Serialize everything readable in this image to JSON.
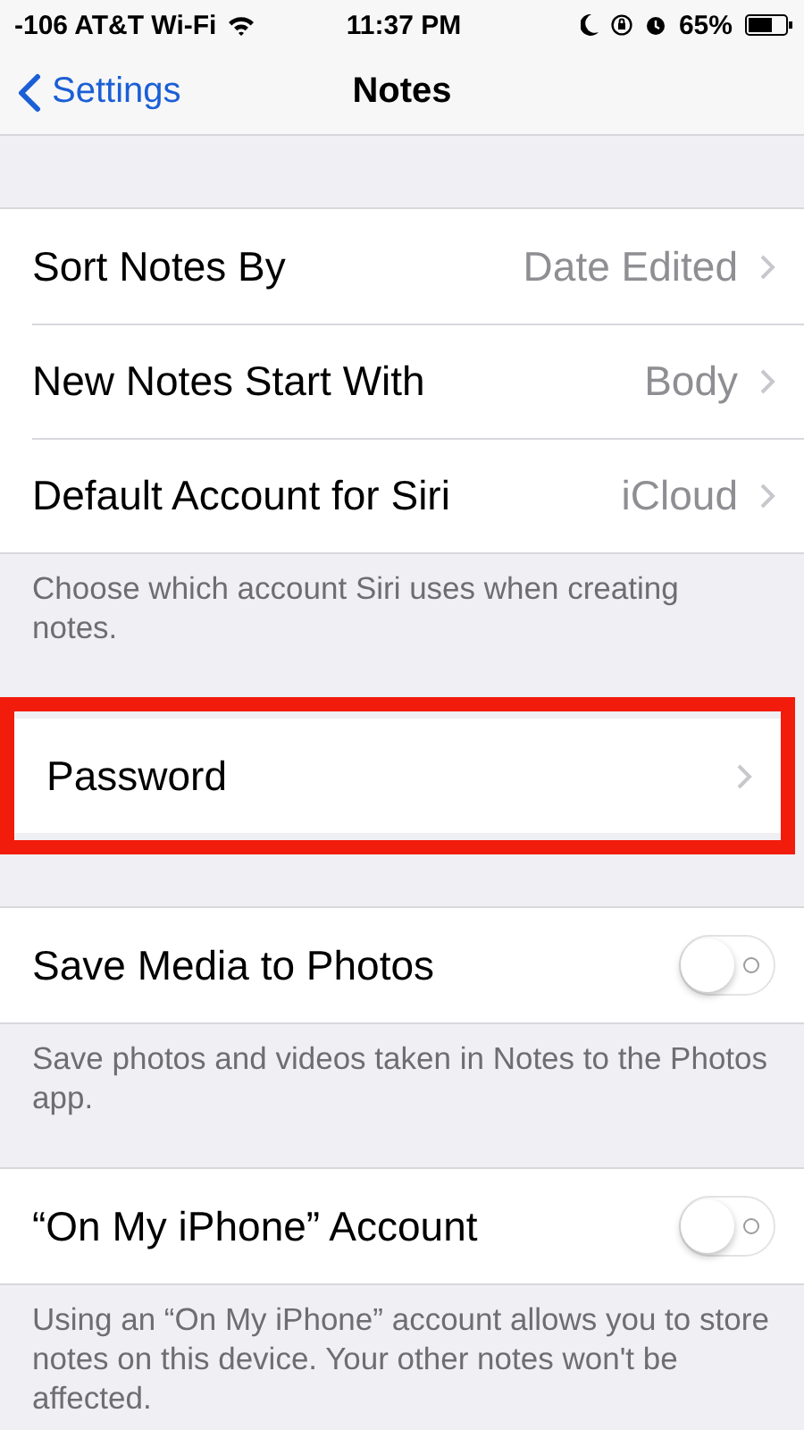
{
  "status_bar": {
    "carrier": "-106 AT&T Wi-Fi",
    "time": "11:37 PM",
    "battery": "65%"
  },
  "nav": {
    "back": "Settings",
    "title": "Notes"
  },
  "groups": [
    {
      "highlighted": false,
      "rows": [
        {
          "kind": "disclosure",
          "label": "Sort Notes By",
          "value": "Date Edited"
        },
        {
          "kind": "disclosure",
          "label": "New Notes Start With",
          "value": "Body"
        },
        {
          "kind": "disclosure",
          "label": "Default Account for Siri",
          "value": "iCloud"
        }
      ],
      "footer": "Choose which account Siri uses when creating notes."
    },
    {
      "highlighted": true,
      "rows": [
        {
          "kind": "disclosure",
          "label": "Password"
        }
      ]
    },
    {
      "highlighted": false,
      "rows": [
        {
          "kind": "toggle",
          "label": "Save Media to Photos",
          "on": false
        }
      ],
      "footer": "Save photos and videos taken in Notes to the Photos app."
    },
    {
      "highlighted": false,
      "rows": [
        {
          "kind": "toggle",
          "label": "“On My iPhone” Account",
          "on": false
        }
      ],
      "footer": "Using an “On My iPhone” account allows you to store notes on this device. Your other notes won't be affected."
    }
  ]
}
